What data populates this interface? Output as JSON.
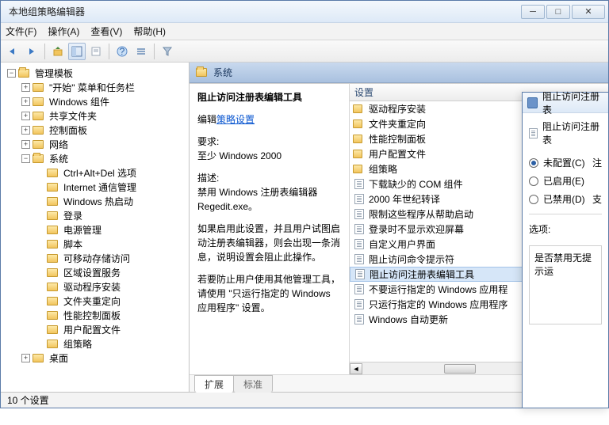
{
  "window": {
    "title": "本地组策略编辑器"
  },
  "menu": {
    "file": "文件(F)",
    "action": "操作(A)",
    "view": "查看(V)",
    "help": "帮助(H)"
  },
  "tree": {
    "root": "管理模板",
    "items": [
      "\"开始\" 菜单和任务栏",
      "Windows 组件",
      "共享文件夹",
      "控制面板",
      "网络"
    ],
    "system": "系统",
    "system_children": [
      "Ctrl+Alt+Del 选项",
      "Internet 通信管理",
      "Windows 热启动",
      "登录",
      "电源管理",
      "脚本",
      "可移动存储访问",
      "区域设置服务",
      "驱动程序安装",
      "文件夹重定向",
      "性能控制面板",
      "用户配置文件",
      "组策略"
    ],
    "desktop": "桌面"
  },
  "header": {
    "title": "系统"
  },
  "desc": {
    "title": "阻止访问注册表编辑工具",
    "edit_prefix": "编辑",
    "edit_link": "策略设置",
    "req_label": "要求:",
    "req_value": "至少 Windows 2000",
    "desc_label": "描述:",
    "desc_value": "禁用 Windows 注册表编辑器 Regedit.exe。",
    "para1": "如果启用此设置，并且用户试图启动注册表编辑器，则会出现一条消息，说明设置会阻止此操作。",
    "para2": "若要防止用户使用其他管理工具，请使用 \"只运行指定的 Windows 应用程序\" 设置。"
  },
  "list": {
    "header": "设置",
    "folders": [
      "驱动程序安装",
      "文件夹重定向",
      "性能控制面板",
      "用户配置文件",
      "组策略"
    ],
    "policies": [
      "下载缺少的 COM 组件",
      "2000 年世纪转译",
      "限制这些程序从帮助启动",
      "登录时不显示欢迎屏幕",
      "自定义用户界面",
      "阻止访问命令提示符",
      "阻止访问注册表编辑工具",
      "不要运行指定的 Windows 应用程",
      "只运行指定的 Windows 应用程序",
      "Windows 自动更新"
    ],
    "selected_index": 6
  },
  "tabs": {
    "extended": "扩展",
    "standard": "标准"
  },
  "status": {
    "text": "10 个设置"
  },
  "dialog": {
    "title": "阻止访问注册表",
    "subhead": "阻止访问注册表",
    "radio_unconfigured": "未配置(C)",
    "radio_enabled": "已启用(E)",
    "radio_disabled": "已禁用(D)",
    "right_char1": "注",
    "right_char2": "支",
    "options_label": "选项:",
    "box_text": "是否禁用无提示运"
  }
}
